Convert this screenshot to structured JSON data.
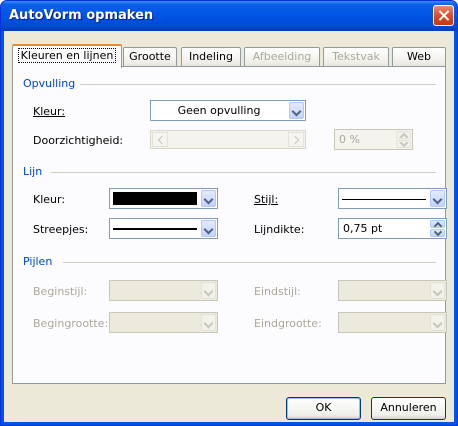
{
  "window": {
    "title": "AutoVorm opmaken"
  },
  "tabs": [
    {
      "label": "Kleuren en lijnen",
      "active": true,
      "enabled": true
    },
    {
      "label": "Grootte",
      "enabled": true
    },
    {
      "label": "Indeling",
      "enabled": true
    },
    {
      "label": "Afbeelding",
      "enabled": false
    },
    {
      "label": "Tekstvak",
      "enabled": false
    },
    {
      "label": "Web",
      "enabled": true
    }
  ],
  "fill": {
    "heading": "Opvulling",
    "color_label": "Kleur:",
    "color_value": "Geen opvulling",
    "transparency_label": "Doorzichtigheid:",
    "transparency_value": "0 %"
  },
  "line": {
    "heading": "Lijn",
    "color_label": "Kleur:",
    "color_value": "#000000",
    "dash_label": "Streepjes:",
    "style_label": "Stijl:",
    "weight_label": "Lijndikte:",
    "weight_value": "0,75 pt"
  },
  "arrows": {
    "heading": "Pijlen",
    "begin_style_label": "Beginstijl:",
    "begin_size_label": "Begingrootte:",
    "end_style_label": "Eindstijl:",
    "end_size_label": "Eindgrootte:"
  },
  "buttons": {
    "ok": "OK",
    "cancel": "Annuleren"
  },
  "colors": {
    "titlebar": "#0055e5",
    "section": "#0046d5",
    "active_tab": "#e68b2c"
  }
}
